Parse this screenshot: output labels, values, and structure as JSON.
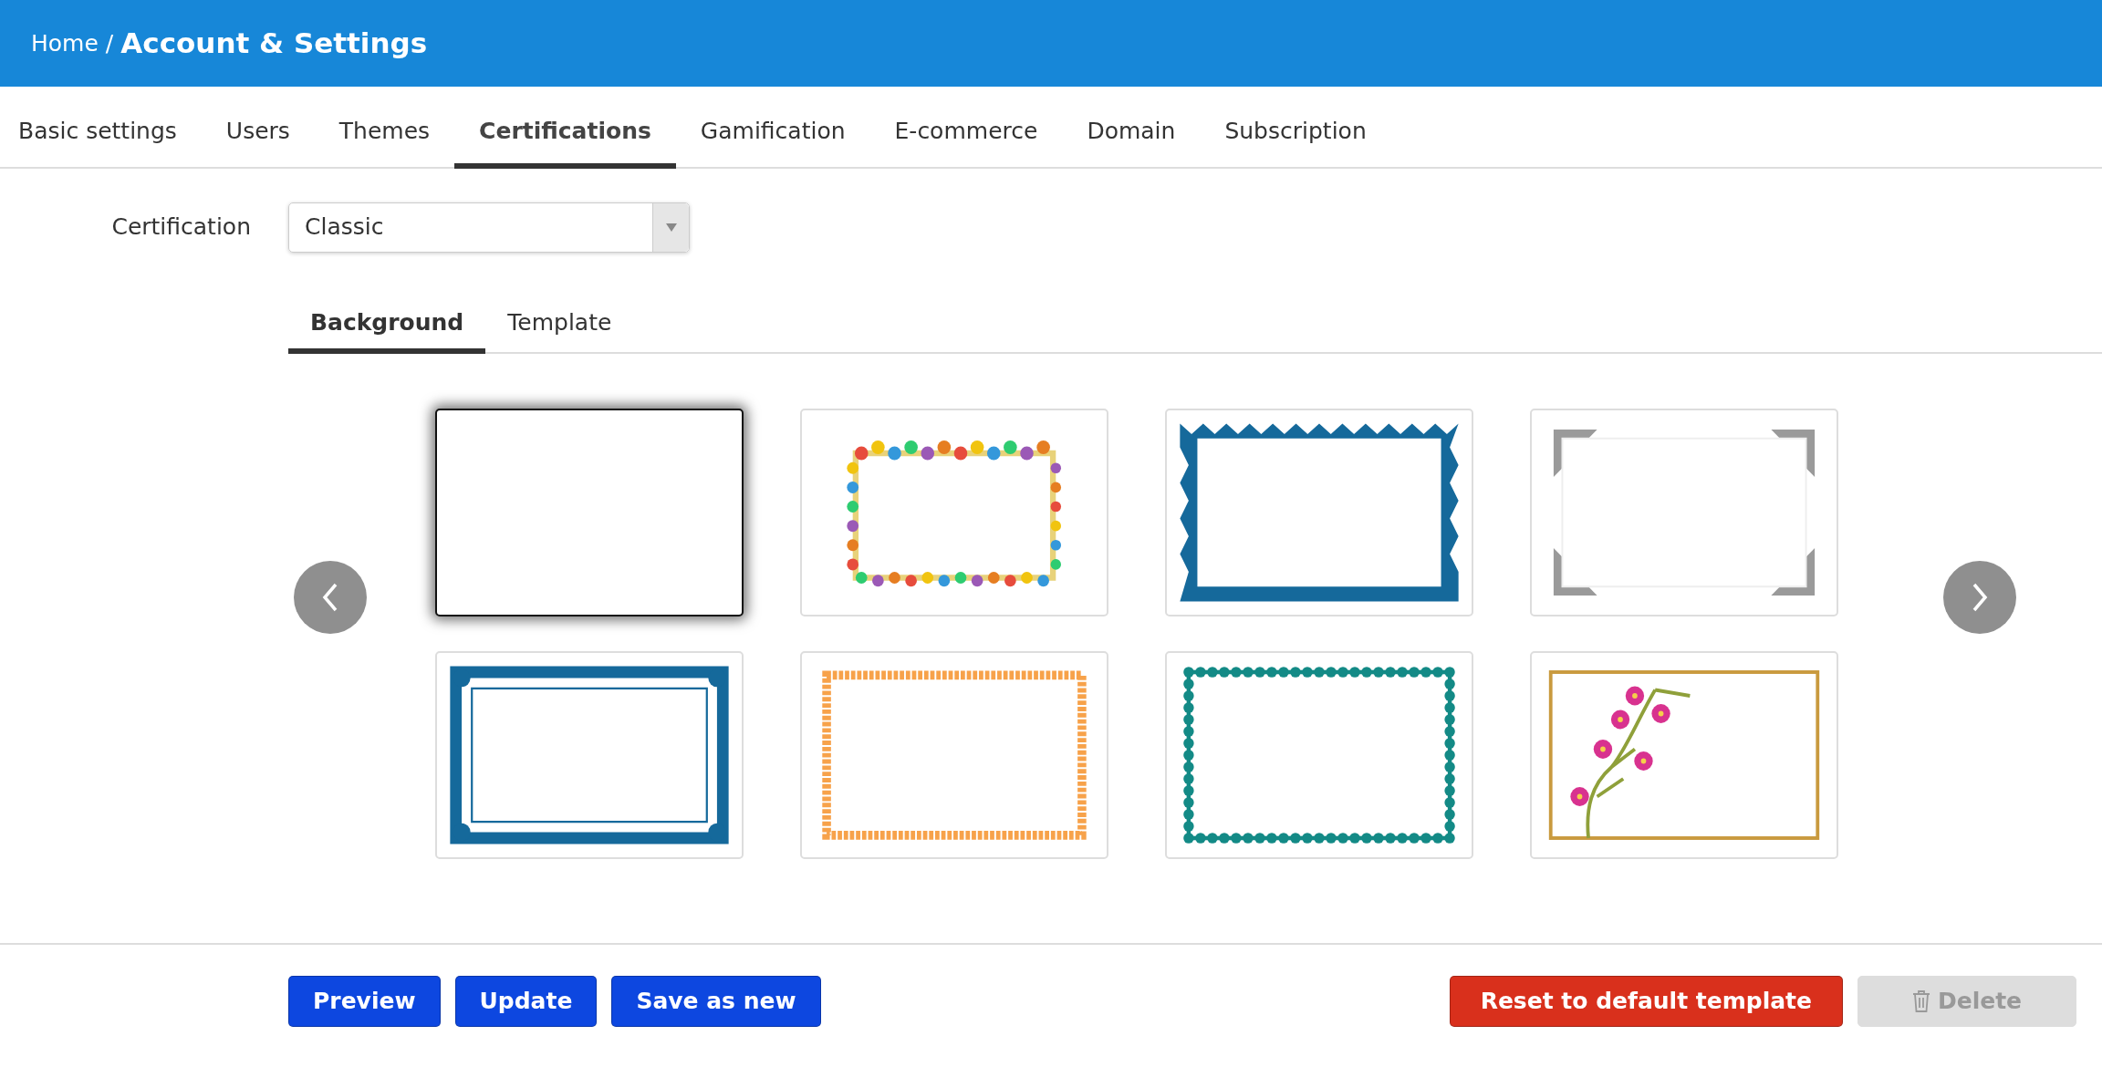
{
  "header": {
    "home": "Home",
    "separator": "/",
    "title": "Account & Settings"
  },
  "tabs": [
    {
      "label": "Basic settings",
      "selected": false
    },
    {
      "label": "Users",
      "selected": false
    },
    {
      "label": "Themes",
      "selected": false
    },
    {
      "label": "Certifications",
      "selected": true
    },
    {
      "label": "Gamification",
      "selected": false
    },
    {
      "label": "E-commerce",
      "selected": false
    },
    {
      "label": "Domain",
      "selected": false
    },
    {
      "label": "Subscription",
      "selected": false
    }
  ],
  "certification": {
    "label": "Certification",
    "value": "Classic"
  },
  "subtabs": [
    {
      "label": "Background",
      "selected": true
    },
    {
      "label": "Template",
      "selected": false
    }
  ],
  "backgrounds": [
    {
      "kind": "blank",
      "selected": true
    },
    {
      "kind": "art",
      "selected": false
    },
    {
      "kind": "zigzag",
      "selected": false
    },
    {
      "kind": "corners",
      "selected": false
    },
    {
      "kind": "classic",
      "selected": false
    },
    {
      "kind": "stars",
      "selected": false
    },
    {
      "kind": "scallop",
      "selected": false
    },
    {
      "kind": "floral",
      "selected": false
    }
  ],
  "buttons": [
    {
      "label": "Preview",
      "kind": "primary",
      "disabled": false
    },
    {
      "label": "Update",
      "kind": "primary",
      "disabled": false
    },
    {
      "label": "Save as new",
      "kind": "primary",
      "disabled": false
    },
    {
      "label": "Reset to default template",
      "kind": "danger",
      "disabled": false
    },
    {
      "label": "Delete",
      "kind": "delete",
      "disabled": true
    }
  ]
}
